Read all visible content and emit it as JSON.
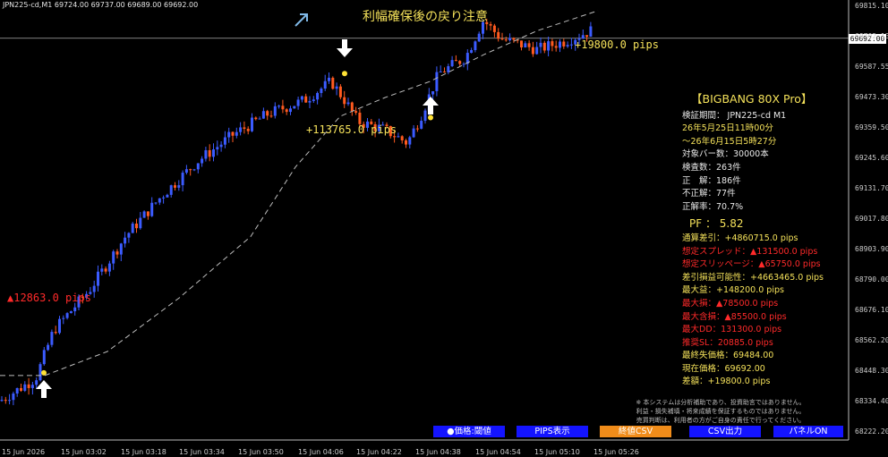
{
  "window": {
    "symbol_info": "JPN225-cd,M1  69724.00 69737.00 69689.00 69692.00",
    "banner_text": "利幅確保後の戻り注意",
    "current_price_tag": "69692.00"
  },
  "chart_labels": {
    "pips_top_right": "+19800.0 pips",
    "pips_middle": "+113765.0 pips",
    "pips_left": "▲12863.0 pips"
  },
  "chart_data": {
    "type": "candlestick",
    "title": "",
    "price_axis_ticks": [
      "69815.10",
      "69702.13",
      "69587.55",
      "69473.30",
      "69359.50",
      "69245.60",
      "69131.70",
      "69017.80",
      "68903.90",
      "68790.00",
      "68676.10",
      "68562.20",
      "68448.30",
      "68334.40",
      "68222.20"
    ],
    "time_axis_ticks": [
      "15 Jun 2026",
      "15 Jun 03:02",
      "15 Jun 03:18",
      "15 Jun 03:34",
      "15 Jun 03:50",
      "15 Jun 04:06",
      "15 Jun 04:22",
      "15 Jun 04:38",
      "15 Jun 04:54",
      "15 Jun 05:10",
      "15 Jun 05:26"
    ],
    "ylim": [
      68222.2,
      69815.1
    ],
    "current_price": 69692.0,
    "signals": [
      {
        "direction": "buy",
        "price": 68440
      },
      {
        "direction": "sell",
        "price": 69560
      },
      {
        "direction": "buy",
        "price": 69395
      }
    ]
  },
  "panel": {
    "title": "【BIGBANG 80X Pro】",
    "lines": [
      {
        "text": "検証期間： JPN225-cd M1",
        "color": "white"
      },
      {
        "text": "26年5月25日11時00分",
        "color": "yellow"
      },
      {
        "text": "～26年6月15日5時27分",
        "color": "yellow"
      },
      {
        "text": "対象バー数：30000本",
        "color": "white"
      },
      {
        "text": "検査数：263件",
        "color": "white"
      },
      {
        "text": "正　解：186件",
        "color": "white"
      },
      {
        "text": "不正解：77件",
        "color": "white"
      },
      {
        "text": "正解率：70.7%",
        "color": "white"
      }
    ],
    "pf_label": "PF ： 5.82",
    "lines2": [
      {
        "text": "通算差引：+4860715.0 pips",
        "color": "yellow"
      },
      {
        "text": "想定スプレッド：▲131500.0 pips",
        "color": "red"
      },
      {
        "text": "想定スリッページ：▲65750.0 pips",
        "color": "red"
      },
      {
        "text": "差引損益可能性：+4663465.0 pips",
        "color": "yellow"
      },
      {
        "text": "最大益：+148200.0 pips",
        "color": "yellow"
      },
      {
        "text": "最大損：▲78500.0 pips",
        "color": "red"
      },
      {
        "text": "最大含損：▲85500.0 pips",
        "color": "red"
      },
      {
        "text": "最大DD：131300.0 pips",
        "color": "red"
      },
      {
        "text": "推奨SL：20885.0 pips",
        "color": "red"
      },
      {
        "text": "最終失価格：69484.00",
        "color": "yellow"
      },
      {
        "text": "現在価格：69692.00",
        "color": "yellow"
      },
      {
        "text": "差額：+19800.0 pips",
        "color": "yellow"
      }
    ]
  },
  "disclaimer": [
    "※ 本システムは分析補助であり、投資助言ではありません。",
    "利益・損失補填・将来成績を保証するものではありません。",
    "売買判断は、利用者の方がご自身の責任で行ってください。"
  ],
  "buttons": [
    {
      "label": "●価格:閾値",
      "color": "#1414ff"
    },
    {
      "label": "PIPS表示",
      "color": "#1414ff"
    },
    {
      "label": "終値CSV",
      "color": "#f08c1a"
    },
    {
      "label": "CSV出力",
      "color": "#1414ff"
    },
    {
      "label": "パネルON",
      "color": "#1414ff"
    }
  ]
}
